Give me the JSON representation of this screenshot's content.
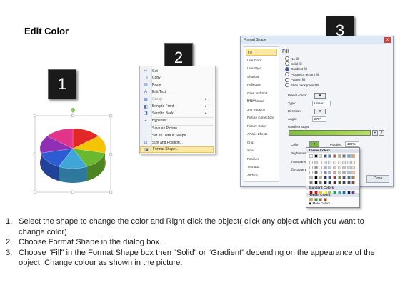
{
  "title": "Edit Color",
  "badges": [
    "1",
    "2",
    "3"
  ],
  "context_menu": {
    "items": [
      {
        "icon": "scissors-icon",
        "glyph": "✂",
        "label": "Cut",
        "submenu": false,
        "disabled": false
      },
      {
        "icon": "copy-icon",
        "glyph": "❐",
        "label": "Copy",
        "submenu": false,
        "disabled": false
      },
      {
        "icon": "paste-icon",
        "glyph": "▤",
        "label": "Paste",
        "submenu": false,
        "disabled": false
      },
      {
        "icon": "edit-text-icon",
        "glyph": "A",
        "label": "Edit Text",
        "submenu": false,
        "disabled": false
      },
      {
        "icon": "group-icon",
        "glyph": "▦",
        "label": "Group",
        "submenu": true,
        "disabled": true
      },
      {
        "icon": "bring-front-icon",
        "glyph": "◧",
        "label": "Bring to Front",
        "submenu": true,
        "disabled": false
      },
      {
        "icon": "send-back-icon",
        "glyph": "◨",
        "label": "Send to Back",
        "submenu": true,
        "disabled": false
      },
      {
        "icon": "hyperlink-icon",
        "glyph": "⚭",
        "label": "Hyperlink...",
        "submenu": false,
        "disabled": false
      },
      {
        "icon": "save-picture-icon",
        "glyph": "",
        "label": "Save as Picture...",
        "submenu": false,
        "disabled": false
      },
      {
        "icon": "default-shape-icon",
        "glyph": "",
        "label": "Set as Default Shape",
        "submenu": false,
        "disabled": false
      },
      {
        "icon": "size-position-icon",
        "glyph": "⊡",
        "label": "Size and Position...",
        "submenu": false,
        "disabled": false
      },
      {
        "icon": "format-shape-icon",
        "glyph": "◪",
        "label": "Format Shape...",
        "submenu": false,
        "disabled": false,
        "selected": true
      }
    ]
  },
  "dialog": {
    "title": "Format Shape",
    "close": "x",
    "nav": [
      "Fill",
      "Line Color",
      "Line Style",
      "Shadow",
      "Reflection",
      "Glow and Soft Edges",
      "3-D Format",
      "3-D Rotation",
      "Picture Corrections",
      "Picture Color",
      "Artistic Effects",
      "Crop",
      "Size",
      "Position",
      "Text Box",
      "Alt Text"
    ],
    "heading": "Fill",
    "fill_options": [
      "No fill",
      "Solid fill",
      "Gradient fill",
      "Picture or texture fill",
      "Pattern fill",
      "Slide background fill"
    ],
    "selected_fill": "Gradient fill",
    "preset_label": "Preset colors:",
    "type_label": "Type:",
    "type_value": "Linear",
    "direction_label": "Direction:",
    "angle_label": "Angle:",
    "angle_value": "270°",
    "stops_label": "Gradient stops",
    "color_label": "Color",
    "position_label": "Position:",
    "position_value": "100%",
    "brightness_label": "Brightness:",
    "transparency_label": "Transparency:",
    "rotate_label": "Rotate with shape",
    "close_button": "Close"
  },
  "color_popup": {
    "theme_header": "Theme Colors",
    "standard_header": "Standard Colors",
    "recent_header": "Recent Colors",
    "more": "More Colors...",
    "theme_row": [
      "#ffffff",
      "#000000",
      "#eeece1",
      "#1f497d",
      "#4f81bd",
      "#c0504d",
      "#9bbb59",
      "#8064a2",
      "#4bacc6",
      "#f79646"
    ],
    "standard_row": [
      "#c00000",
      "#ff0000",
      "#ffc000",
      "#ffff00",
      "#92d050",
      "#00b050",
      "#00b0f0",
      "#0070c0",
      "#002060",
      "#7030a0"
    ],
    "recent_row": [
      "#ff9900",
      "#339933",
      "#996633",
      "#cc3300"
    ]
  },
  "pie_colors": [
    "#e32626",
    "#f5c400",
    "#69b82f",
    "#3fa6d8",
    "#2d5bd3",
    "#8e2fb6",
    "#e3348c"
  ],
  "steps": [
    {
      "num": "1.",
      "text": "Select the shape to change the color and Right click the object( click any object which you want to change color)"
    },
    {
      "num": "2.",
      "text": "Choose Format Shape in the dialog box."
    },
    {
      "num": "3.",
      "text": "Choose “Fill” in the Format Shape box then “Solid” or “Gradient” depending on the appearance of the object. Change colour as shown in the picture."
    }
  ]
}
